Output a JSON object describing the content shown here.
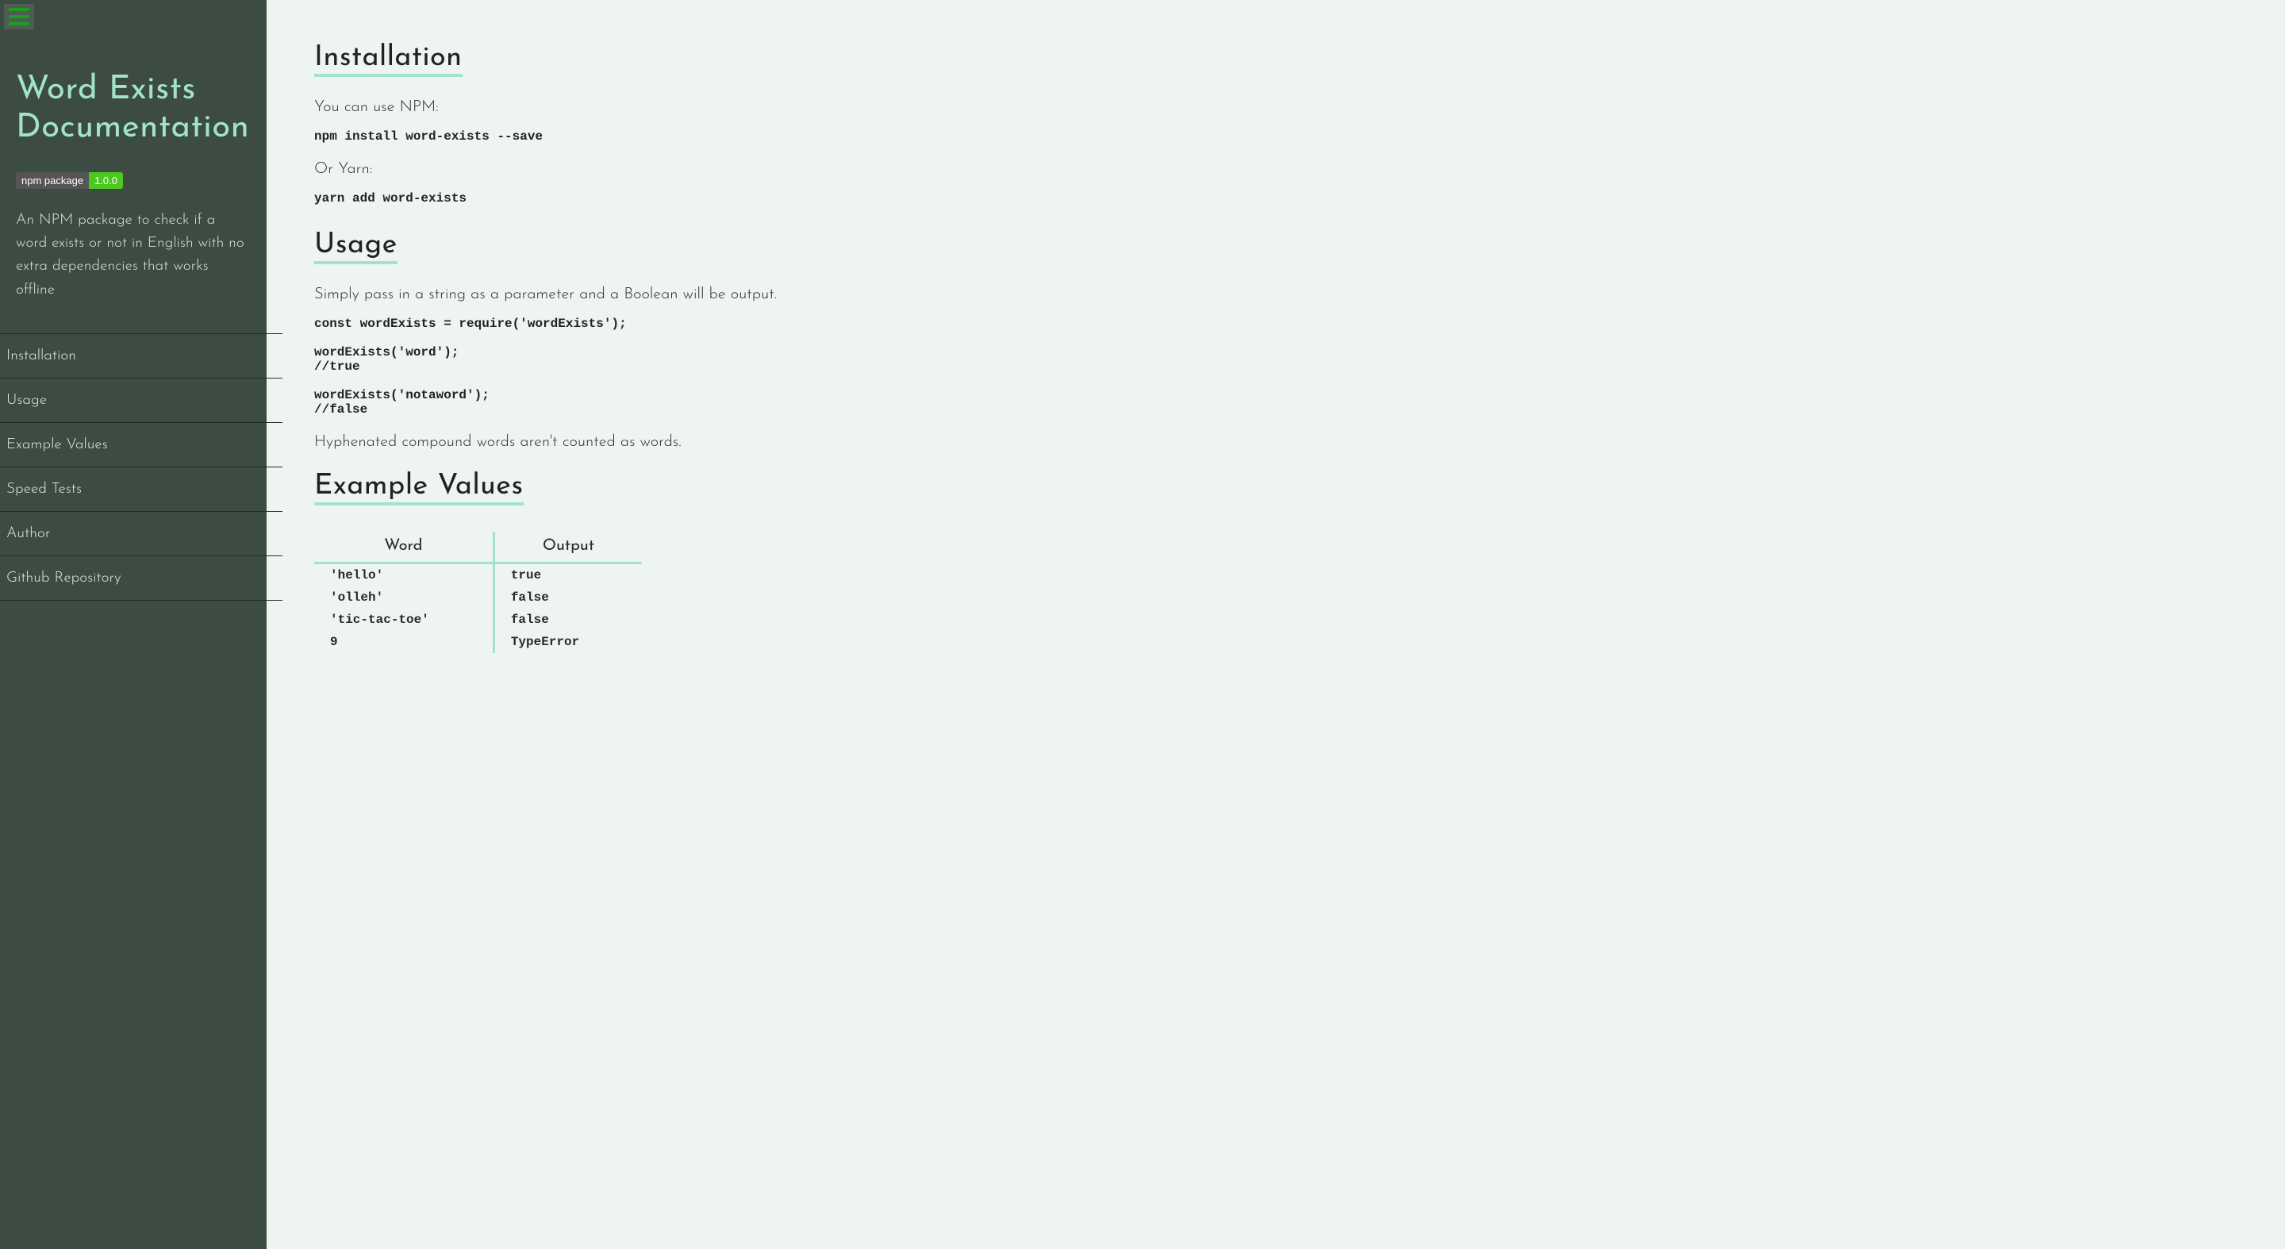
{
  "sidebar": {
    "title": "Word Exists Documentation",
    "badge": {
      "label": "npm package",
      "value": "1.0.0"
    },
    "description": "An NPM package to check if a word exists or not in English with no extra dependencies that works offline",
    "nav": [
      "Installation",
      "Usage",
      "Example Values",
      "Speed Tests",
      "Author",
      "Github Repository"
    ]
  },
  "main": {
    "installation": {
      "heading": "Installation",
      "npm_text": "You can use NPM:",
      "npm_cmd": "npm install word-exists --save",
      "yarn_text": "Or Yarn:",
      "yarn_cmd": "yarn add word-exists"
    },
    "usage": {
      "heading": "Usage",
      "intro": "Simply pass in a string as a parameter and a Boolean will be output.",
      "code": "const wordExists = require('wordExists');\n\nwordExists('word');\n//true\n\nwordExists('notaword');\n//false",
      "note": "Hyphenated compound words aren't counted as words."
    },
    "examples": {
      "heading": "Example Values",
      "headers": [
        "Word",
        "Output"
      ],
      "rows": [
        [
          "'hello'",
          "true"
        ],
        [
          "'olleh'",
          "false"
        ],
        [
          "'tic-tac-toe'",
          "false"
        ],
        [
          "9",
          "TypeError"
        ]
      ]
    }
  }
}
